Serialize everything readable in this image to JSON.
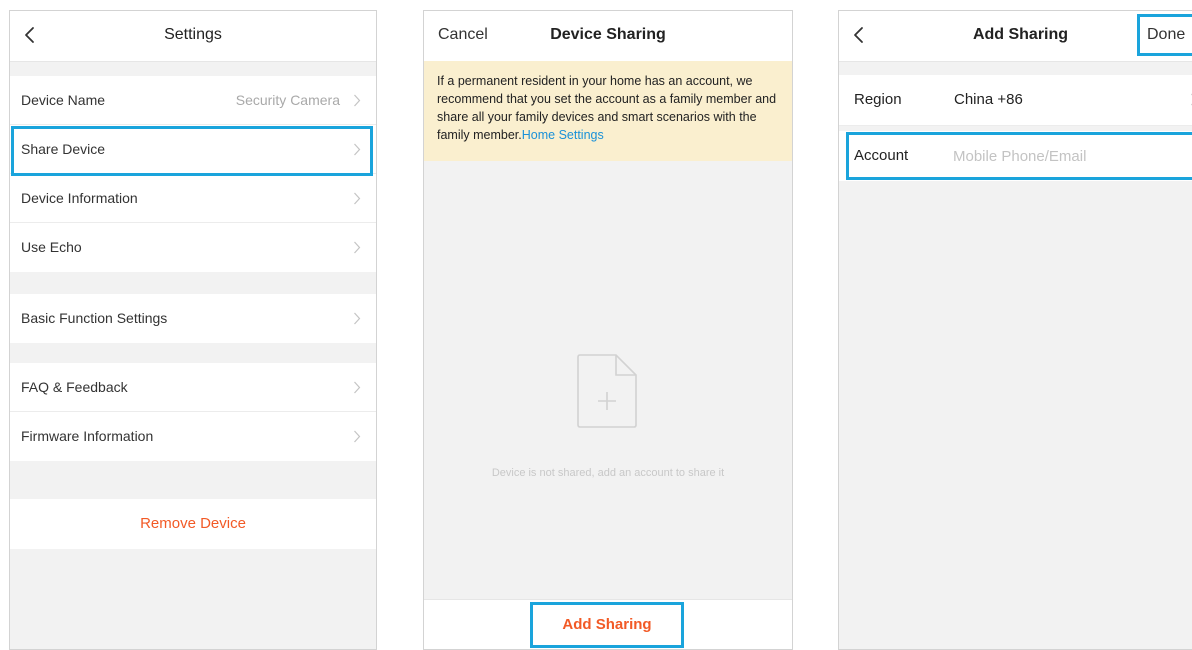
{
  "settings": {
    "title": "Settings",
    "rows": [
      {
        "label": "Device Name",
        "value": "Security Camera"
      },
      {
        "label": "Share Device"
      },
      {
        "label": "Device Information"
      },
      {
        "label": "Use Echo"
      },
      {
        "label": "Basic Function Settings"
      },
      {
        "label": "FAQ & Feedback"
      },
      {
        "label": "Firmware Information"
      }
    ],
    "remove_label": "Remove Device"
  },
  "device_sharing": {
    "cancel_label": "Cancel",
    "title": "Device Sharing",
    "notice_text": "If a permanent resident in your home has an account, we recommend that you set the account as a family member and share all your family devices and smart scenarios with the family member.",
    "notice_link": "Home Settings",
    "empty_text": "Device is not shared, add an account to share it",
    "add_button_label": "Add Sharing"
  },
  "add_sharing": {
    "title": "Add Sharing",
    "done_label": "Done",
    "region_label": "Region",
    "region_value": "China +86",
    "account_label": "Account",
    "account_placeholder": "Mobile Phone/Email",
    "account_value": ""
  },
  "colors": {
    "highlight": "#1aa4dc",
    "accent_orange": "#f25a26",
    "link_blue": "#1a91d8",
    "notice_bg": "#faefcf",
    "page_bg": "#f2f2f2"
  },
  "icons": [
    "back-arrow-icon",
    "chevron-right-icon",
    "empty-file-plus-icon"
  ]
}
